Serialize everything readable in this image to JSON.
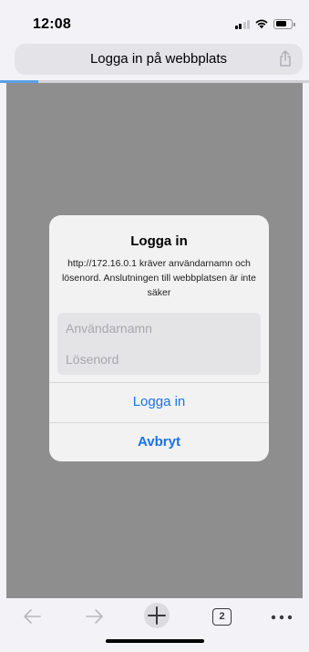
{
  "status_bar": {
    "time": "12:08"
  },
  "address_bar": {
    "title": "Logga in på webbplats",
    "load_progress": 0.13
  },
  "dialog": {
    "title": "Logga in",
    "message": "http://172.16.0.1 kräver användarnamn och lösenord. Anslutningen till webbplatsen är inte säker",
    "username_placeholder": "Användarnamn",
    "password_placeholder": "Lösenord",
    "login_label": "Logga in",
    "cancel_label": "Avbryt"
  },
  "toolbar": {
    "tab_count": "2"
  },
  "colors": {
    "accent": "#1a73e8",
    "overlay": "#8e8e8e",
    "dialog_bg": "#f2f2f2"
  }
}
